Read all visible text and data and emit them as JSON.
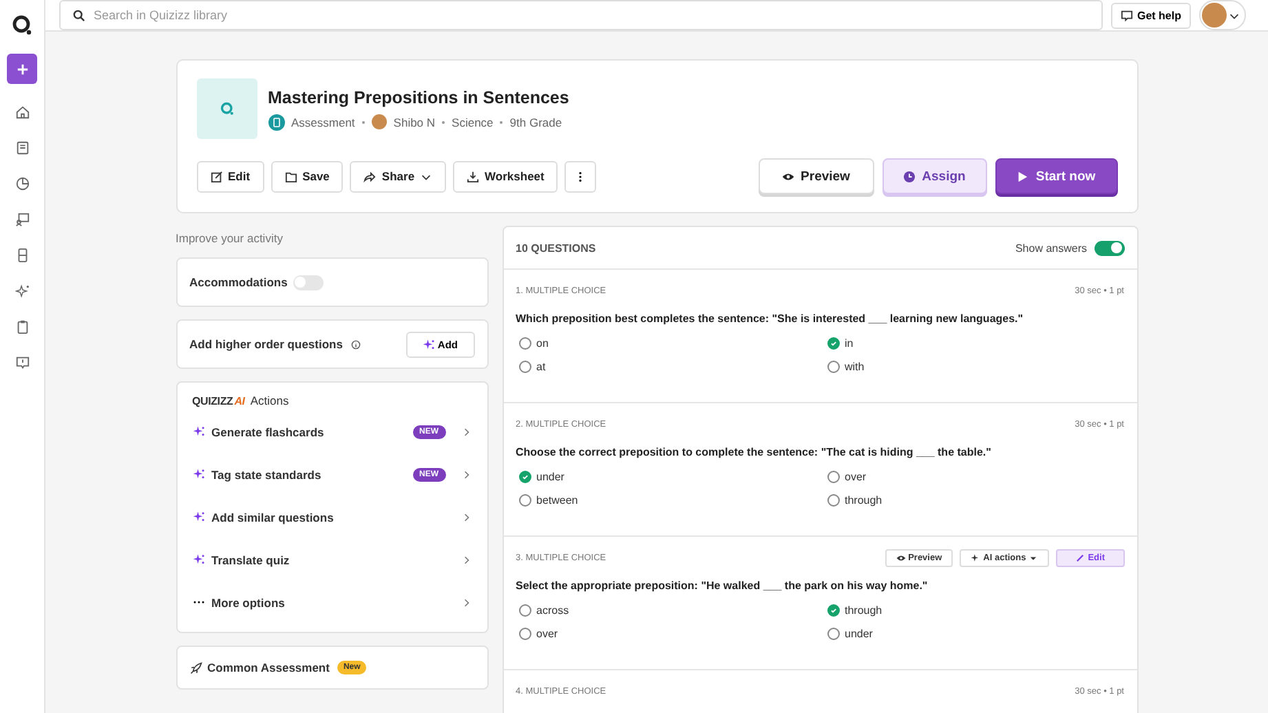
{
  "search": {
    "placeholder": "Search in Quizizz library"
  },
  "get_help": "Get help",
  "activity": {
    "title": "Mastering Prepositions in Sentences",
    "type": "Assessment",
    "author": "Shibo N",
    "subject": "Science",
    "grade": "9th Grade",
    "tools": [
      {
        "kind": "edit",
        "label": "Edit"
      },
      {
        "kind": "save",
        "label": "Save"
      },
      {
        "kind": "share",
        "label": "Share"
      },
      {
        "kind": "worksheet",
        "label": "Worksheet"
      },
      {
        "kind": "more"
      }
    ],
    "actions": [
      {
        "kind": "preview",
        "label": "Preview"
      },
      {
        "kind": "assign",
        "label": "Assign"
      },
      {
        "kind": "start",
        "label": "Start now"
      }
    ]
  },
  "improve": {
    "heading": "Improve your activity",
    "accommodations": {
      "label": "Accommodations",
      "on": false
    },
    "higher_order": {
      "label": "Add higher order questions",
      "button": "Add"
    },
    "ai": {
      "brand": "QUIZIZZ",
      "brand_ai": "AI",
      "title": "Actions",
      "items": [
        {
          "kind": "ai",
          "label": "Generate flashcards",
          "badge": "NEW"
        },
        {
          "kind": "ai",
          "label": "Tag state standards",
          "badge": "NEW"
        },
        {
          "kind": "ai",
          "label": "Add similar questions"
        },
        {
          "kind": "ai",
          "label": "Translate quiz"
        },
        {
          "kind": "more",
          "label": "More options"
        }
      ]
    },
    "common": {
      "label": "Common Assessment",
      "badge": "New"
    }
  },
  "questions": {
    "count": "10 QUESTIONS",
    "show_answers": {
      "label": "Show answers",
      "on": true
    },
    "items": [
      {
        "header": "1. MULTIPLE CHOICE",
        "meta": "30 sec • 1 pt",
        "text": "Which preposition best completes the sentence: \"She is interested ___ learning new languages.\"",
        "options": [
          {
            "label": "on",
            "correct": false
          },
          {
            "label": "in",
            "correct": true
          },
          {
            "label": "at",
            "correct": false
          },
          {
            "label": "with",
            "correct": false
          }
        ]
      },
      {
        "header": "2. MULTIPLE CHOICE",
        "meta": "30 sec • 1 pt",
        "text": "Choose the correct preposition to complete the sentence: \"The cat is hiding ___ the table.\"",
        "options": [
          {
            "label": "under",
            "correct": true
          },
          {
            "label": "over",
            "correct": false
          },
          {
            "label": "between",
            "correct": false
          },
          {
            "label": "through",
            "correct": false
          }
        ]
      },
      {
        "header": "3. MULTIPLE CHOICE",
        "buttons": [
          {
            "kind": "preview",
            "label": "Preview"
          },
          {
            "kind": "ai",
            "label": "AI actions"
          },
          {
            "kind": "edit",
            "label": "Edit"
          }
        ],
        "text": "Select the appropriate preposition: \"He walked ___ the park on his way home.\"",
        "options": [
          {
            "label": "across",
            "correct": false
          },
          {
            "label": "through",
            "correct": true
          },
          {
            "label": "over",
            "correct": false
          },
          {
            "label": "under",
            "correct": false
          }
        ]
      },
      {
        "header": "4. MULTIPLE CHOICE",
        "meta": "30 sec • 1 pt"
      }
    ]
  }
}
